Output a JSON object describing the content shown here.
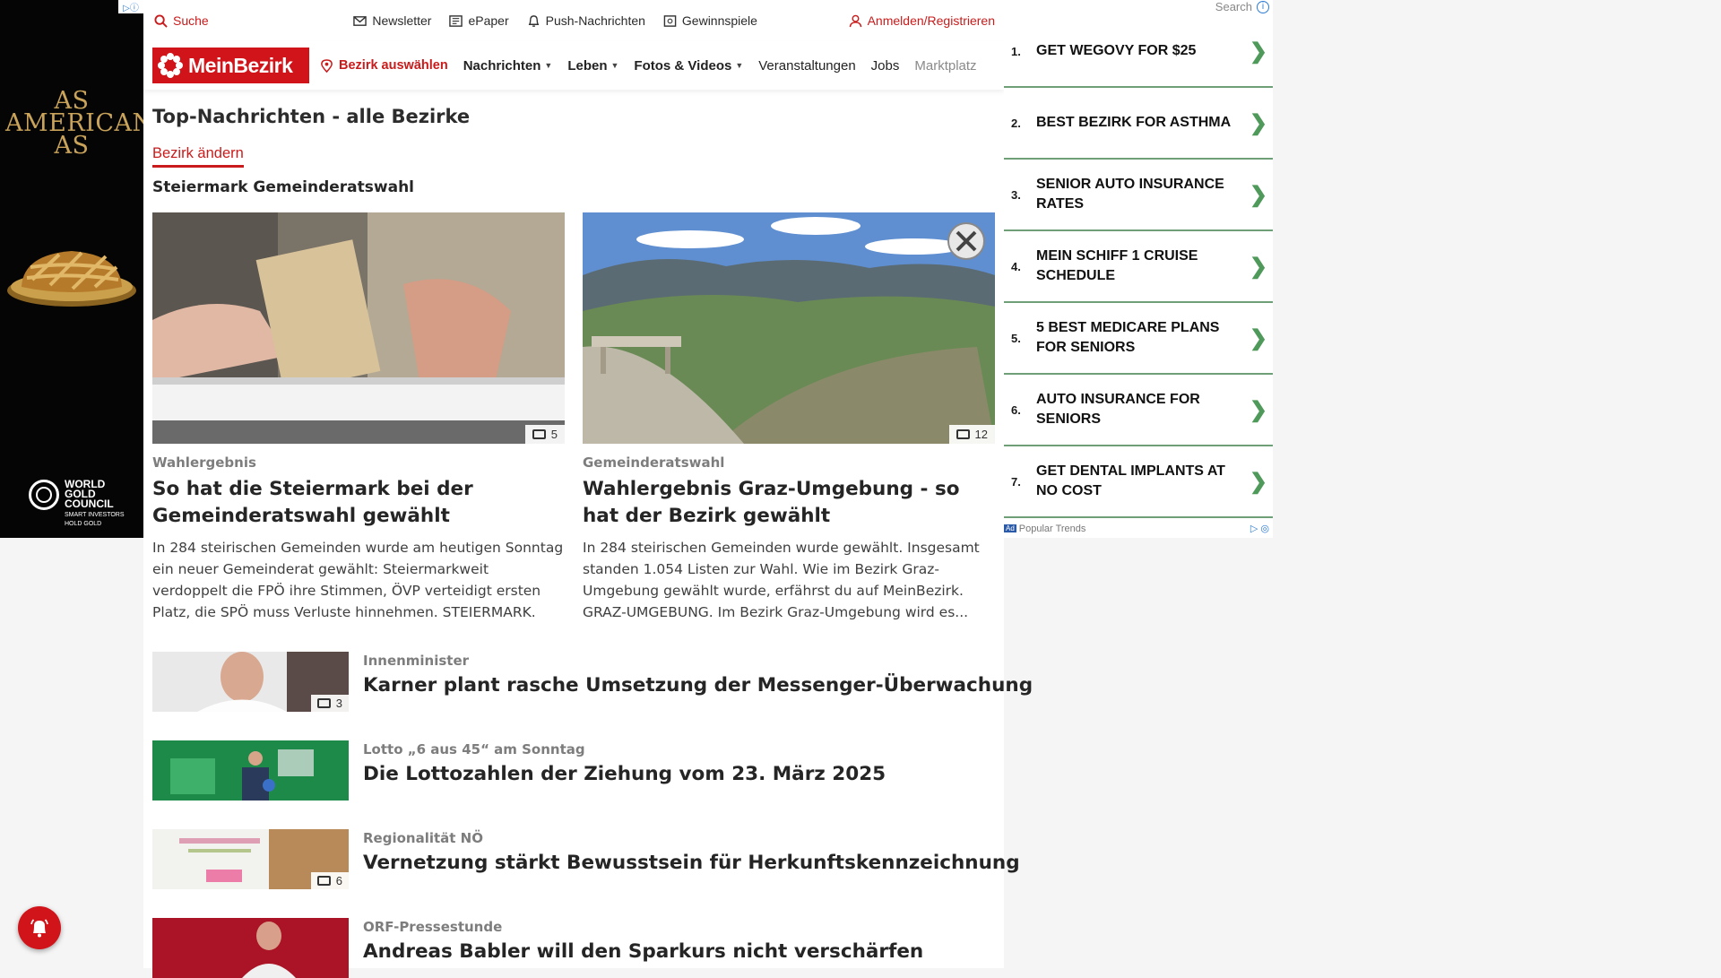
{
  "left_ad": {
    "headline": "AS AMERICAN AS",
    "brand_line1": "WORLD",
    "brand_line2": "GOLD",
    "brand_line3": "COUNCIL",
    "brand_sub1": "SMART INVESTORS",
    "brand_sub2": "HOLD GOLD"
  },
  "topbar": {
    "search_label": "Suche",
    "newsletter_label": "Newsletter",
    "epaper_label": "ePaper",
    "push_label": "Push-Nachrichten",
    "gewinnspiele_label": "Gewinnspiele",
    "login_label": "Anmelden/Registrieren"
  },
  "navbar": {
    "logo_text": "MeinBezirk",
    "region_label": "Bezirk auswählen",
    "items": [
      {
        "label": "Nachrichten",
        "dropdown": true
      },
      {
        "label": "Leben",
        "dropdown": true
      },
      {
        "label": "Fotos & Videos",
        "dropdown": true
      },
      {
        "label": "Veranstaltungen",
        "dropdown": false
      },
      {
        "label": "Jobs",
        "dropdown": false
      },
      {
        "label": "Marktplatz",
        "dropdown": false
      }
    ]
  },
  "page": {
    "title": "Top-Nachrichten - alle Bezirke",
    "change_district": "Bezirk ändern",
    "section_title": "Steiermark Gemeinderatswahl"
  },
  "featured": [
    {
      "kicker": "Wahlergebnis",
      "headline": "So hat die Steiermark bei der Gemeinderatswahl gewählt",
      "teaser": "In 284 steirischen Gemeinden wurde am heutigen Sonntag ein neuer Gemeinderat gewählt: Steiermarkweit verdoppelt die FPÖ ihre Stimmen, ÖVP verteidigt ersten Platz, die SPÖ muss Verluste hinnehmen.  STEIERMARK. Di...",
      "photo_count": "5"
    },
    {
      "kicker": "Gemeinderatswahl",
      "headline": "Wahlergebnis Graz-Umgebung - so hat der Bezirk gewählt",
      "teaser": "In 284 steirischen Gemeinden wurde gewählt. Insgesamt standen 1.054 Listen zur Wahl. Wie im Bezirk Graz-Umgebung gewählt wurde, erfährst du auf MeinBezirk. GRAZ-UMGEBUNG. Im Bezirk Graz-Umgebung wird es...",
      "photo_count": "12"
    }
  ],
  "articles": [
    {
      "kicker": "Innenminister",
      "headline": "Karner plant rasche Umsetzung der Messenger-Überwachung",
      "photo_count": "3"
    },
    {
      "kicker": "Lotto „6 aus 45“ am Sonntag",
      "headline": "Die Lottozahlen der Ziehung vom 23. März 2025",
      "photo_count": ""
    },
    {
      "kicker": "Regionalität NÖ",
      "headline": "Vernetzung stärkt Bewusstsein für Herkunftskennzeichnung",
      "photo_count": "6"
    },
    {
      "kicker": "ORF-Pressestunde",
      "headline": "Andreas Babler will den Sparkurs nicht verschärfen",
      "photo_count": ""
    }
  ],
  "right_ad": {
    "search_label": "Search",
    "items": [
      {
        "num": "1.",
        "label": "GET WEGOVY FOR $25"
      },
      {
        "num": "2.",
        "label": "BEST BEZIRK FOR ASTHMA"
      },
      {
        "num": "3.",
        "label": "SENIOR AUTO INSURANCE RATES"
      },
      {
        "num": "4.",
        "label": "MEIN SCHIFF 1 CRUISE SCHEDULE"
      },
      {
        "num": "5.",
        "label": "5 BEST MEDICARE PLANS FOR SENIORS"
      },
      {
        "num": "6.",
        "label": "AUTO INSURANCE FOR SENIORS"
      },
      {
        "num": "7.",
        "label": "GET DENTAL IMPLANTS AT NO COST"
      }
    ],
    "footer_ad": "Ad",
    "footer_label": "Popular Trends"
  },
  "colors": {
    "brand_red": "#d0141a",
    "ad_accent_green": "#4f9a5a"
  }
}
